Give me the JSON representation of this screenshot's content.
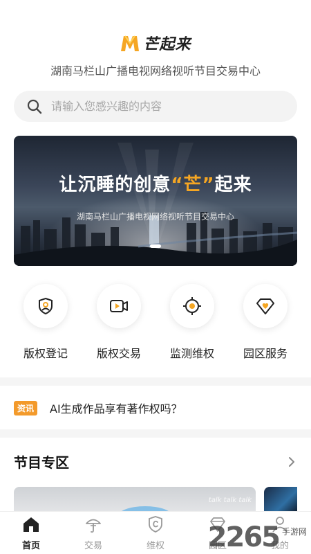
{
  "header": {
    "logo_text": "芒起来",
    "subtitle": "湖南马栏山广播电视网络视听节目交易中心"
  },
  "search": {
    "placeholder": "请输入您感兴趣的内容",
    "icon": "search-icon"
  },
  "banner": {
    "title_before": "让沉睡的创意",
    "title_highlight": "“芒”",
    "title_after": "起来",
    "subtitle": "湖南马栏山广播电视网络视听节目交易中心"
  },
  "services": [
    {
      "label": "版权登记",
      "icon": "copyright-register-icon"
    },
    {
      "label": "版权交易",
      "icon": "video-trade-icon"
    },
    {
      "label": "监测维权",
      "icon": "monitor-target-icon"
    },
    {
      "label": "园区服务",
      "icon": "park-service-icon"
    }
  ],
  "news": {
    "tag": "资讯",
    "text": "AI生成作品享有著作权吗？"
  },
  "program_section": {
    "title": "节目专区"
  },
  "card_preview": {
    "overlay_text": "talk talk talk"
  },
  "tabbar": [
    {
      "label": "首页",
      "icon": "home-icon",
      "active": true
    },
    {
      "label": "交易",
      "icon": "trade-icon",
      "active": false
    },
    {
      "label": "维权",
      "icon": "shield-copyright-icon",
      "active": false
    },
    {
      "label": "园区",
      "icon": "park-icon",
      "active": false
    },
    {
      "label": "我的",
      "icon": "user-icon",
      "active": false
    }
  ],
  "watermark": {
    "number": "2265",
    "text": "手游网"
  },
  "colors": {
    "accent": "#f5a623",
    "news_tag": "#f39a2b",
    "search_bg": "#f3f3f3"
  }
}
